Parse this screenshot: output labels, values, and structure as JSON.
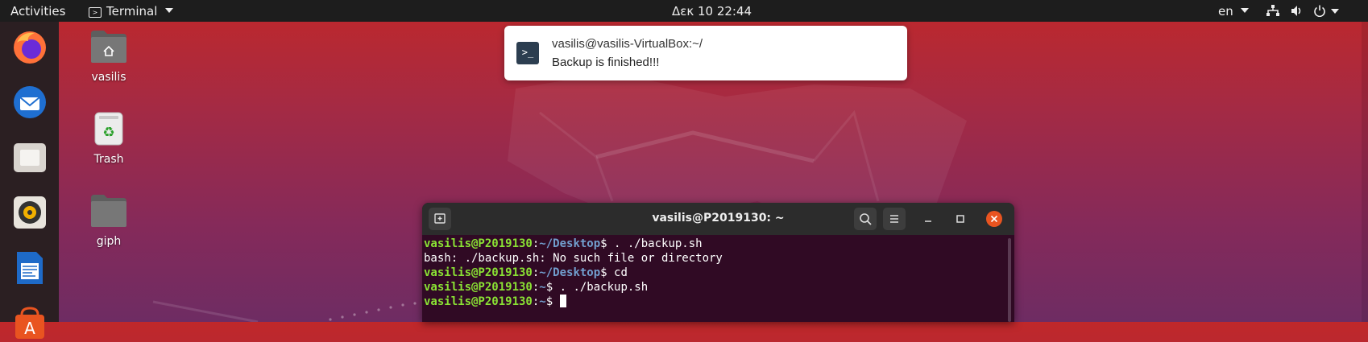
{
  "topbar": {
    "activities": "Activities",
    "app_menu": "Terminal",
    "clock": "Δεκ 10  22:44",
    "lang": "en"
  },
  "desktop": {
    "icons": [
      {
        "label": "vasilis"
      },
      {
        "label": "Trash"
      },
      {
        "label": "giph"
      }
    ]
  },
  "notification": {
    "title": "vasilis@vasilis-VirtualBox:~/",
    "body": "Backup is finished!!!",
    "icon_text": ">_"
  },
  "terminal": {
    "title": "vasilis@P2019130: ~",
    "lines": [
      {
        "user": "vasilis@P2019130",
        "sep": ":",
        "path": "~/Desktop",
        "cmd": "$ . ./backup.sh"
      },
      {
        "text": "bash: ./backup.sh: No such file or directory"
      },
      {
        "user": "vasilis@P2019130",
        "sep": ":",
        "path": "~/Desktop",
        "cmd": "$ cd"
      },
      {
        "user": "vasilis@P2019130",
        "sep": ":",
        "path": "~",
        "cmd": "$ . ./backup.sh"
      },
      {
        "user": "vasilis@P2019130",
        "sep": ":",
        "path": "~",
        "cmd": "$ "
      }
    ]
  },
  "colors": {
    "accent_close": "#e95420",
    "prompt_user": "#8ae234",
    "prompt_path": "#729fcf"
  }
}
